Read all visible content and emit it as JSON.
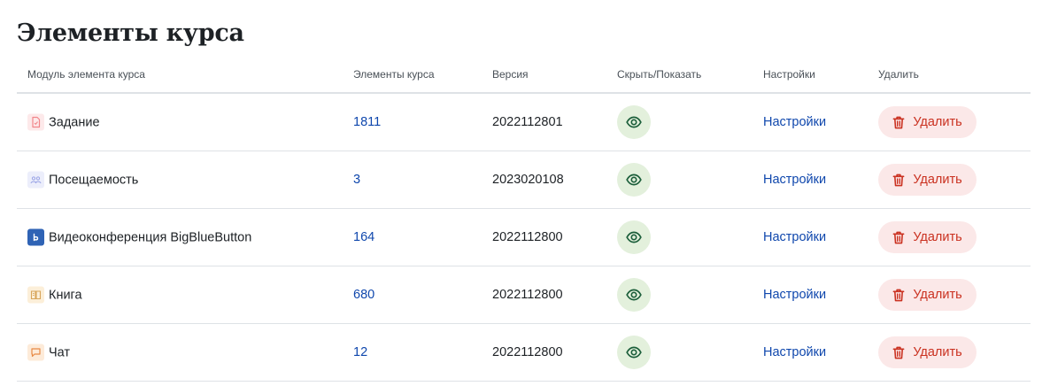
{
  "page": {
    "title": "Элементы курса"
  },
  "table": {
    "headers": {
      "module": "Модуль элемента курса",
      "count": "Элементы курса",
      "version": "Версия",
      "visibility": "Скрыть/Показать",
      "settings": "Настройки",
      "delete": "Удалить"
    },
    "rows": [
      {
        "name": "Задание",
        "icon": "assignment-icon",
        "icon_bg": "#fde9ea",
        "icon_color": "#f1868a",
        "count": "1811",
        "version": "2022112801",
        "settings": "Настройки",
        "delete": "Удалить"
      },
      {
        "name": "Посещаемость",
        "icon": "attendance-icon",
        "icon_bg": "#eceefb",
        "icon_color": "#9aa4e6",
        "count": "3",
        "version": "2023020108",
        "settings": "Настройки",
        "delete": "Удалить"
      },
      {
        "name": "Видеоконференция BigBlueButton",
        "icon": "bigbluebutton-icon",
        "icon_bg": "#2f63b5",
        "icon_color": "#ffffff",
        "count": "164",
        "version": "2022112800",
        "settings": "Настройки",
        "delete": "Удалить"
      },
      {
        "name": "Книга",
        "icon": "book-icon",
        "icon_bg": "#fcefd9",
        "icon_color": "#d8a55a",
        "count": "680",
        "version": "2022112800",
        "settings": "Настройки",
        "delete": "Удалить"
      },
      {
        "name": "Чат",
        "icon": "chat-icon",
        "icon_bg": "#fdebd9",
        "icon_color": "#e88a45",
        "count": "12",
        "version": "2022112800",
        "settings": "Настройки",
        "delete": "Удалить"
      }
    ]
  },
  "colors": {
    "link": "#0f47ad",
    "eye_bg": "#e3f0dc",
    "eye_icon": "#1b5e3a",
    "delete_bg": "#fbe8e8",
    "delete_text": "#ca3120"
  }
}
